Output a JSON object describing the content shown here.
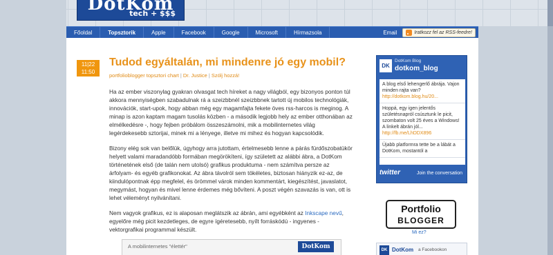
{
  "header": {
    "logo_text": "DotKom",
    "logo_tagline": "tech + $$$"
  },
  "nav": {
    "items": [
      {
        "label": "Főoldal"
      },
      {
        "label": "Topsztorik"
      },
      {
        "label": "Apple"
      },
      {
        "label": "Facebook"
      },
      {
        "label": "Google"
      },
      {
        "label": "Microsoft"
      },
      {
        "label": "Hírmazsola"
      }
    ],
    "active": "Topsztorik",
    "email_label": "Email",
    "rss_label": "Iratkozz fel az RSS-feedre!"
  },
  "post": {
    "date_day": "11|22",
    "date_time": "11:50",
    "title": "Tudod egyáltalán, mi mindenre jó egy mobil?",
    "meta_tags": "portfolioblogger topsztori chart",
    "meta_author": "Dr. Justice",
    "meta_comment": "Szólj hozzá!",
    "paragraph1": "Ha az ember viszonylag gyakran olvasgat tech híreket a nagy világból, egy bizonyos ponton túl akkora mennyiségben szabadulnak rá a szeizbbnél szeizbbnek tartott új mobilos technológiák, innovációk, start-upok, hogy abban még egy magamfajta fekete öves rss-harcos is meginog. A minap is azon kaptam magam tusolás közben - a második legjobb hely az ember otthonában az elmélkedésre -, hogy fejben próbálom összeszámolni, mik a mobilinternetes világ legérdekesebb sztorijai, minek mi a lényege, illetve mi mihez és hogyan kapcsolódik.",
    "paragraph2": "Bizony elég sok van belőlük, úgyhogy arra jutottam, értelmesebb lenne a párás fürdőszobatükör helyett valami maradandóbb formában megörökíteni, így született az alábbi ábra, a DotKom történetének első (de talán nem utolsó) grafikus produktuma - nem számítva persze az árfolyam- és egyéb grafikonokat. Az ábra távolról sem tökéletes, biztosan hiányzik ez-az, de kiindulópontnak épp megfelel, és örömmel várok minden kommentárt, kiegészítést, javaslatot, megymást, hogyan és mivel lenne érdemes még bővíteni. A poszt végén szavazás is van, ott is lehet véleményt nyilvánítani.",
    "paragraph3_pre": "Nem vagyok grafikus, ez is alaposan meglátszik az ábrán, ami egyébként az ",
    "paragraph3_link": "Inkscape nevű",
    "paragraph3_post": ", egyelőre még picit kezdetleges, de egyre ígéretesebb, nyílt forráskódú - ingyenes - vektorgrafikai programmal készült.",
    "image_caption": "A mobilinternetes \"élettér\"",
    "image_logo": "DotKom"
  },
  "twitter": {
    "header_small": "DotKom Blog",
    "account": "dotkom_blog",
    "badge": "DK",
    "tweets": [
      {
        "text": "A blog első lehengerlő ábrája. Vajon minden rajta van?",
        "link": "http://dotkom.blog.hu/20..."
      },
      {
        "text": "Hoppá, egy igen jelentős születésnapról csúsztunk le picit, szombaton volt 25 éves a Windows! A linkelt ábrán jól...",
        "link": "http://fb.me/LhDDX896"
      },
      {
        "text": "Újabb platformra tette be a lábát a DotKom, mostantól a",
        "link": ""
      }
    ],
    "footer_logo": "twitter",
    "join_label": "Join the conversation"
  },
  "portfolio": {
    "line1": "Portfolio",
    "line2": "BLOGGER",
    "what_is": "Mi ez?"
  },
  "facebook": {
    "badge": "DK",
    "brand": "DotKom",
    "text": "a Facebookon"
  }
}
